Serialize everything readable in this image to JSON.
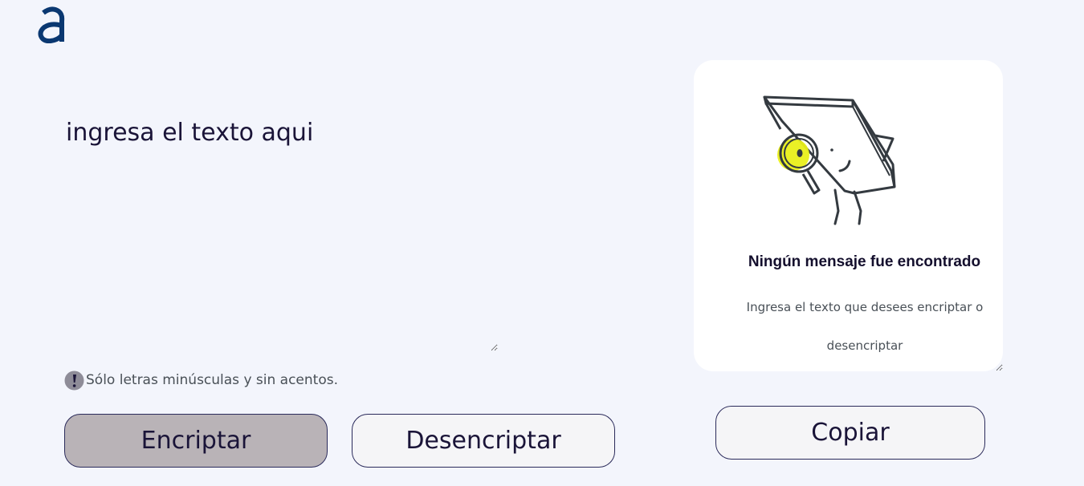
{
  "app": {
    "logo_icon": "alura-logo-icon"
  },
  "input": {
    "placeholder": "ingresa el texto aqui",
    "value": ""
  },
  "hint": {
    "icon": "exclamation-circle-icon",
    "text": "Sólo letras minúsculas y sin acentos."
  },
  "buttons": {
    "encrypt_label": "Encriptar",
    "decrypt_label": "Desencriptar",
    "copy_label": "Copiar"
  },
  "output": {
    "illustration": "magnifying-glass-character-icon",
    "title": "Ningún mensaje fue encontrado",
    "message": "Ingresa el texto que desees encriptar o desencriptar"
  },
  "colors": {
    "background": "#f3f5fc",
    "primary_text": "#1a1438",
    "encrypt_button_bg": "#b9b3b7",
    "secondary_button_bg": "#f5f5f7",
    "logo_blue": "#0a3871",
    "highlight_yellow": "#e9ef1a"
  }
}
